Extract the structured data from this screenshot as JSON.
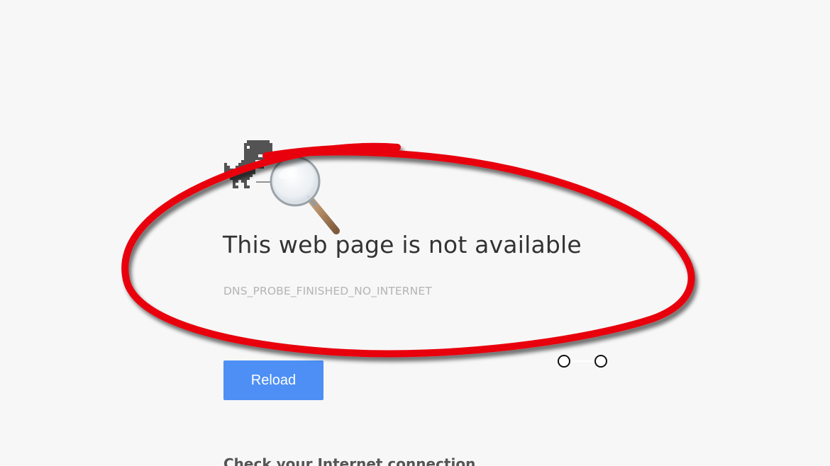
{
  "error_page": {
    "title": "This web page is not available",
    "error_code": "DNS_PROBE_FINISHED_NO_INTERNET",
    "reload_label": "Reload",
    "check_heading": "Check your Internet connection"
  },
  "icons": {
    "offline": "dino-icon",
    "zoom": "magnifier-icon"
  },
  "colors": {
    "background": "#f7f7f7",
    "title_text": "#333333",
    "error_code_text": "#b4b4b4",
    "button": "#4d8ff5",
    "annotation": "#e8000b"
  }
}
